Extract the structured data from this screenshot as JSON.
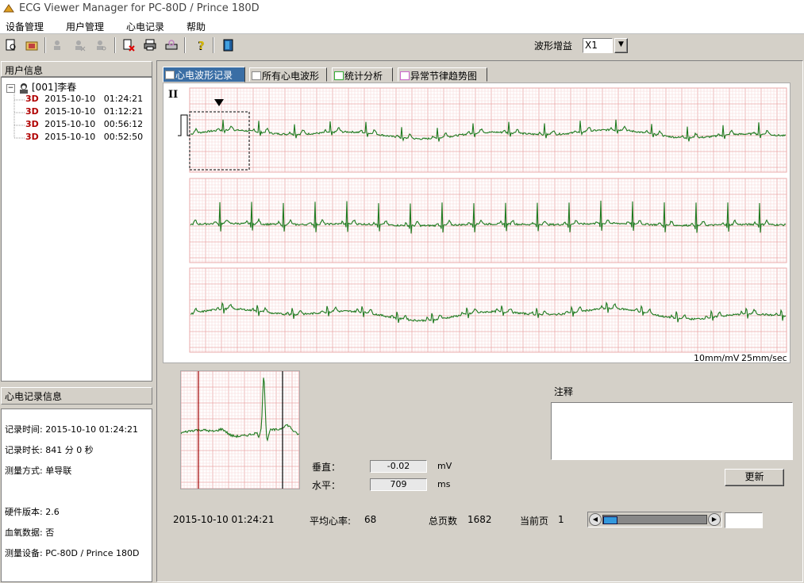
{
  "window": {
    "title": "ECG Viewer Manager for PC-80D / Prince 180D"
  },
  "menu": [
    "设备管理",
    "用户管理",
    "心电记录",
    "帮助"
  ],
  "toolbar": {
    "gain_label": "波形增益",
    "gain_value": "X1"
  },
  "user_panel": {
    "header": "用户信息",
    "user": "[001]李春",
    "records": [
      {
        "badge": "3D",
        "date": "2015-10-10",
        "time": "01:24:21"
      },
      {
        "badge": "3D",
        "date": "2015-10-10",
        "time": "01:12:21"
      },
      {
        "badge": "3D",
        "date": "2015-10-10",
        "time": "00:56:12"
      },
      {
        "badge": "3D",
        "date": "2015-10-10",
        "time": "00:52:50"
      }
    ]
  },
  "record_panel": {
    "header": "心电记录信息",
    "rows": [
      "记录时间: 2015-10-10  01:24:21",
      "记录时长: 841 分 0 秒",
      "测量方式: 单导联",
      "硬件版本: 2.6",
      "血氧数据: 否",
      "测量设备: PC-80D / Prince 180D"
    ]
  },
  "tabs": [
    "心电波形记录",
    "所有心电波形",
    "统计分析",
    "异常节律趋势图"
  ],
  "ecg": {
    "lead": "II",
    "scale": "10mm/mV",
    "speed": "25mm/sec"
  },
  "measure": {
    "vertical_label": "垂直：",
    "vertical_value": "-0.02",
    "vertical_unit": "mV",
    "horizontal_label": "水平：",
    "horizontal_value": "709",
    "horizontal_unit": "ms"
  },
  "notes": {
    "label": "注释",
    "value": "",
    "update_button": "更新"
  },
  "status": {
    "datetime": "2015-10-10   01:24:21",
    "avg_hr_label": "平均心率:",
    "avg_hr_value": "68",
    "total_pages_label": "总页数",
    "total_pages_value": "1682",
    "current_page_label": "当前页",
    "current_page_value": "1",
    "page_position": 0.0
  },
  "colors": {
    "trace": "#1f7a1f",
    "grid_minor": "#f6d5d5",
    "grid_major": "#eaa8a8",
    "tab_active": "#3a6ea5"
  }
}
